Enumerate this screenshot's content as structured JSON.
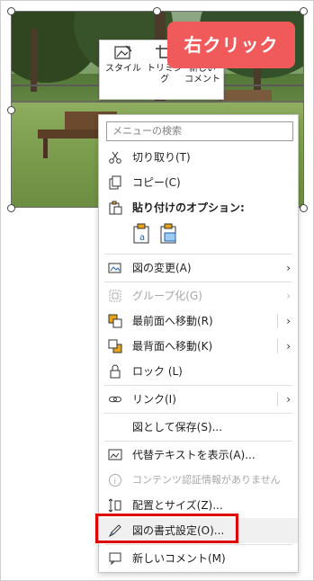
{
  "callout": {
    "text": "右クリック"
  },
  "mini_toolbar": {
    "style_label": "スタイル",
    "trim_label": "トリミング",
    "comment_label_1": "新しい",
    "comment_label_2": "コメント"
  },
  "menu": {
    "search_placeholder": "メニューの検索",
    "cut": "切り取り(T)",
    "copy": "コピー(C)",
    "paste_options": "貼り付けのオプション:",
    "change_picture": "図の変更(A)",
    "group": "グループ化(G)",
    "bring_front": "最前面へ移動(R)",
    "send_back": "最背面へ移動(K)",
    "lock": "ロック (L)",
    "link": "リンク(I)",
    "save_as_picture": "図として保存(S)...",
    "alt_text": "代替テキストを表示(A)...",
    "content_credentials": "コンテンツ認証情報がありません",
    "position_size": "配置とサイズ(Z)...",
    "format_picture": "図の書式設定(O)...",
    "new_comment": "新しいコメント(M)"
  },
  "colors": {
    "callout": "#f15a5a",
    "highlight_box": "#e00000"
  }
}
